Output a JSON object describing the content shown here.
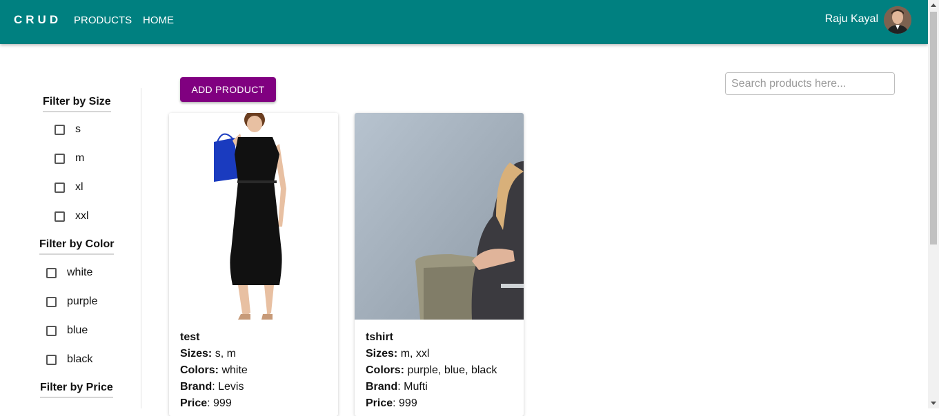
{
  "header": {
    "brand": "CRUD",
    "nav": [
      "PRODUCTS",
      "HOME"
    ],
    "user_name": "Raju Kayal"
  },
  "filters": {
    "size": {
      "title": "Filter by Size",
      "options": [
        "s",
        "m",
        "xl",
        "xxl"
      ]
    },
    "color": {
      "title": "Filter by Color",
      "options": [
        "white",
        "purple",
        "blue",
        "black"
      ]
    },
    "price": {
      "title": "Filter by Price"
    }
  },
  "toolbar": {
    "add_label": "ADD PRODUCT",
    "search_placeholder": "Search products here..."
  },
  "labels": {
    "sizes": "Sizes:",
    "colors": "Colors:",
    "brand": "Brand",
    "price": "Price"
  },
  "products": [
    {
      "title": "test",
      "sizes": "s, m",
      "colors": "white",
      "brand": "Levis",
      "price": "999"
    },
    {
      "title": "tshirt",
      "sizes": "m, xxl",
      "colors": "purple, blue, black",
      "brand": "Mufti",
      "price": "999"
    }
  ],
  "colors": {
    "appbar": "#008080",
    "accent_button": "#800080"
  }
}
